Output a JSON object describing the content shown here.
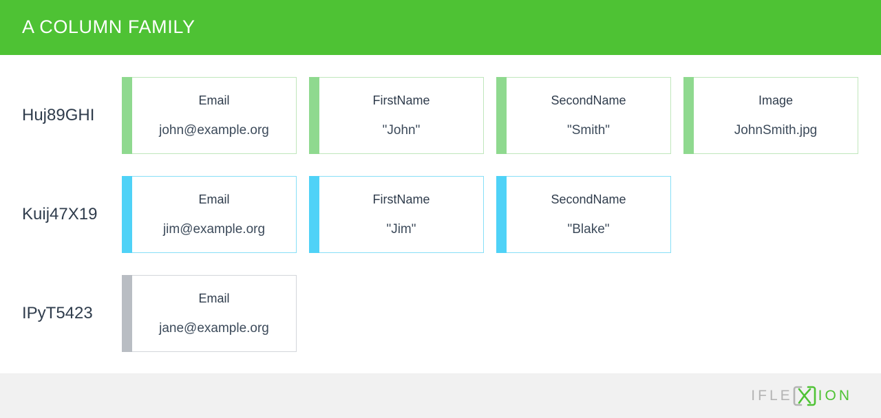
{
  "header": {
    "title": "A COLUMN FAMILY",
    "background_color": "#4ec234",
    "text_color": "#ffffff"
  },
  "colors": {
    "green_accent": "#8fd98f",
    "green_border": "#bfe6bb",
    "cyan_accent": "#4fd2f7",
    "cyan_border": "#86dff7",
    "grey_accent": "#b9bdc3",
    "grey_border": "#d3d6da",
    "brand_green": "#4ec234",
    "footer_background": "#f1f1f1",
    "text_dark": "#2f3c4c"
  },
  "rows": [
    {
      "key": "Huj89GHI",
      "theme": "green",
      "columns": [
        {
          "label": "Email",
          "value": "john@example.org"
        },
        {
          "label": "FirstName",
          "value": "\"John\""
        },
        {
          "label": "SecondName",
          "value": "\"Smith\""
        },
        {
          "label": "Image",
          "value": "JohnSmith.jpg"
        }
      ]
    },
    {
      "key": "Kuij47X19",
      "theme": "cyan",
      "columns": [
        {
          "label": "Email",
          "value": "jim@example.org"
        },
        {
          "label": "FirstName",
          "value": "\"Jim\""
        },
        {
          "label": "SecondName",
          "value": "\"Blake\""
        }
      ]
    },
    {
      "key": "IPyT5423",
      "theme": "grey",
      "columns": [
        {
          "label": "Email",
          "value": "jane@example.org"
        }
      ]
    }
  ],
  "footer": {
    "logo_text_left": "IFLE",
    "logo_text_right": "ION",
    "logo_mark_name": "iflexion-x-bracket-mark"
  }
}
